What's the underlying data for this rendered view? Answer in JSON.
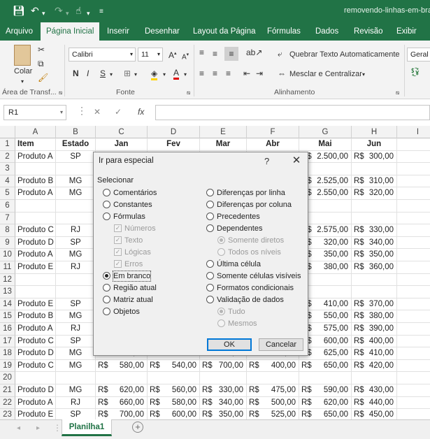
{
  "window": {
    "title": "removendo-linhas-em-bra"
  },
  "tabs": [
    "Arquivo",
    "Página Inicial",
    "Inserir",
    "Desenhar",
    "Layout da Página",
    "Fórmulas",
    "Dados",
    "Revisão",
    "Exibir"
  ],
  "ribbon": {
    "paste_label": "Colar",
    "font_name": "Calibri",
    "font_size": "11",
    "wrap_text": "Quebrar Texto Automaticamente",
    "merge_center": "Mesclar e Centralizar",
    "number_format": "Geral",
    "groups": {
      "clipboard": "Área de Transf...",
      "font": "Fonte",
      "alignment": "Alinhamento"
    }
  },
  "formula_bar": {
    "name_box": "R1",
    "cancel": "✕",
    "enter": "✓",
    "fx": "fx",
    "value": ""
  },
  "columns": [
    "A",
    "B",
    "C",
    "D",
    "E",
    "F",
    "G",
    "H",
    "I"
  ],
  "headers": [
    "Item",
    "Estado",
    "Jan",
    "Fev",
    "Mar",
    "Abr",
    "Mai",
    "Jun"
  ],
  "rows": [
    {
      "n": "1",
      "cells": [
        "Item",
        "Estado",
        "Jan",
        "Fev",
        "Mar",
        "Abr",
        "Mai",
        "Jun"
      ]
    },
    {
      "n": "2",
      "cells": [
        "Produto A",
        "SP",
        "",
        "",
        "",
        "",
        "2.500,00",
        "300,00"
      ]
    },
    {
      "n": "3",
      "cells": [
        "",
        "",
        "",
        "",
        "",
        "",
        "",
        ""
      ]
    },
    {
      "n": "4",
      "cells": [
        "Produto B",
        "MG",
        "",
        "",
        "",
        "",
        "2.525,00",
        "310,00"
      ]
    },
    {
      "n": "5",
      "cells": [
        "Produto A",
        "MG",
        "",
        "",
        "",
        "",
        "2.550,00",
        "320,00"
      ]
    },
    {
      "n": "6",
      "cells": [
        "",
        "",
        "",
        "",
        "",
        "",
        "",
        ""
      ]
    },
    {
      "n": "7",
      "cells": [
        "",
        "",
        "",
        "",
        "",
        "",
        "",
        ""
      ]
    },
    {
      "n": "8",
      "cells": [
        "Produto C",
        "RJ",
        "",
        "",
        "",
        "",
        "2.575,00",
        "330,00"
      ]
    },
    {
      "n": "9",
      "cells": [
        "Produto D",
        "SP",
        "",
        "",
        "",
        "",
        "320,00",
        "340,00"
      ]
    },
    {
      "n": "10",
      "cells": [
        "Produto A",
        "MG",
        "",
        "",
        "",
        "",
        "350,00",
        "350,00"
      ]
    },
    {
      "n": "11",
      "cells": [
        "Produto E",
        "RJ",
        "",
        "",
        "",
        "",
        "380,00",
        "360,00"
      ]
    },
    {
      "n": "12",
      "cells": [
        "",
        "",
        "",
        "",
        "",
        "",
        "",
        ""
      ]
    },
    {
      "n": "13",
      "cells": [
        "",
        "",
        "",
        "",
        "",
        "",
        "",
        ""
      ]
    },
    {
      "n": "14",
      "cells": [
        "Produto E",
        "SP",
        "",
        "",
        "",
        "",
        "410,00",
        "370,00"
      ]
    },
    {
      "n": "15",
      "cells": [
        "Produto B",
        "MG",
        "",
        "",
        "",
        "",
        "550,00",
        "380,00"
      ]
    },
    {
      "n": "16",
      "cells": [
        "Produto A",
        "RJ",
        "",
        "",
        "",
        "",
        "575,00",
        "390,00"
      ]
    },
    {
      "n": "17",
      "cells": [
        "Produto C",
        "SP",
        "",
        "",
        "",
        "",
        "600,00",
        "400,00"
      ]
    },
    {
      "n": "18",
      "cells": [
        "Produto D",
        "MG",
        "540,00",
        "",
        "680,00",
        "350,00",
        "625,00",
        "410,00"
      ]
    },
    {
      "n": "19",
      "cells": [
        "Produto C",
        "MG",
        "580,00",
        "540,00",
        "700,00",
        "400,00",
        "650,00",
        "420,00"
      ]
    },
    {
      "n": "20",
      "cells": [
        "",
        "",
        "",
        "",
        "",
        "",
        "",
        ""
      ]
    },
    {
      "n": "21",
      "cells": [
        "Produto D",
        "MG",
        "620,00",
        "560,00",
        "330,00",
        "475,00",
        "590,00",
        "430,00"
      ]
    },
    {
      "n": "22",
      "cells": [
        "Produto A",
        "RJ",
        "660,00",
        "580,00",
        "340,00",
        "500,00",
        "620,00",
        "440,00"
      ]
    },
    {
      "n": "23",
      "cells": [
        "Produto E",
        "SP",
        "700,00",
        "600,00",
        "350,00",
        "525,00",
        "650,00",
        "450,00"
      ]
    }
  ],
  "currency": "R$",
  "sheet_tab": "Planilha1",
  "dialog": {
    "title": "Ir para especial",
    "help": "?",
    "close": "✕",
    "section": "Selecionar",
    "left_options": [
      {
        "label": "Comentários",
        "type": "radio",
        "disabled": false,
        "selected": false
      },
      {
        "label": "Constantes",
        "type": "radio",
        "disabled": false,
        "selected": false
      },
      {
        "label": "Fórmulas",
        "type": "radio",
        "disabled": false,
        "selected": false
      },
      {
        "label": "Números",
        "type": "check",
        "disabled": true,
        "checked": true
      },
      {
        "label": "Texto",
        "type": "check",
        "disabled": true,
        "checked": true
      },
      {
        "label": "Lógicas",
        "type": "check",
        "disabled": true,
        "checked": true
      },
      {
        "label": "Erros",
        "type": "check",
        "disabled": true,
        "checked": true
      },
      {
        "label": "Em branco",
        "type": "radio",
        "disabled": false,
        "selected": true
      },
      {
        "label": "Região atual",
        "type": "radio",
        "disabled": false,
        "selected": false
      },
      {
        "label": "Matriz atual",
        "type": "radio",
        "disabled": false,
        "selected": false
      },
      {
        "label": "Objetos",
        "type": "radio",
        "disabled": false,
        "selected": false
      }
    ],
    "right_options": [
      {
        "label": "Diferenças por linha",
        "type": "radio",
        "disabled": false,
        "selected": false
      },
      {
        "label": "Diferenças por coluna",
        "type": "radio",
        "disabled": false,
        "selected": false
      },
      {
        "label": "Precedentes",
        "type": "radio",
        "disabled": false,
        "selected": false
      },
      {
        "label": "Dependentes",
        "type": "radio",
        "disabled": false,
        "selected": false
      },
      {
        "label": "Somente diretos",
        "type": "radio",
        "disabled": true,
        "selected": true
      },
      {
        "label": "Todos os níveis",
        "type": "radio",
        "disabled": true,
        "selected": false
      },
      {
        "label": "Última célula",
        "type": "radio",
        "disabled": false,
        "selected": false
      },
      {
        "label": "Somente células visíveis",
        "type": "radio",
        "disabled": false,
        "selected": false
      },
      {
        "label": "Formatos condicionais",
        "type": "radio",
        "disabled": false,
        "selected": false
      },
      {
        "label": "Validação de dados",
        "type": "radio",
        "disabled": false,
        "selected": false
      },
      {
        "label": "Tudo",
        "type": "radio",
        "disabled": true,
        "selected": true
      },
      {
        "label": "Mesmos",
        "type": "radio",
        "disabled": true,
        "selected": false
      }
    ],
    "ok": "OK",
    "cancel": "Cancelar"
  }
}
